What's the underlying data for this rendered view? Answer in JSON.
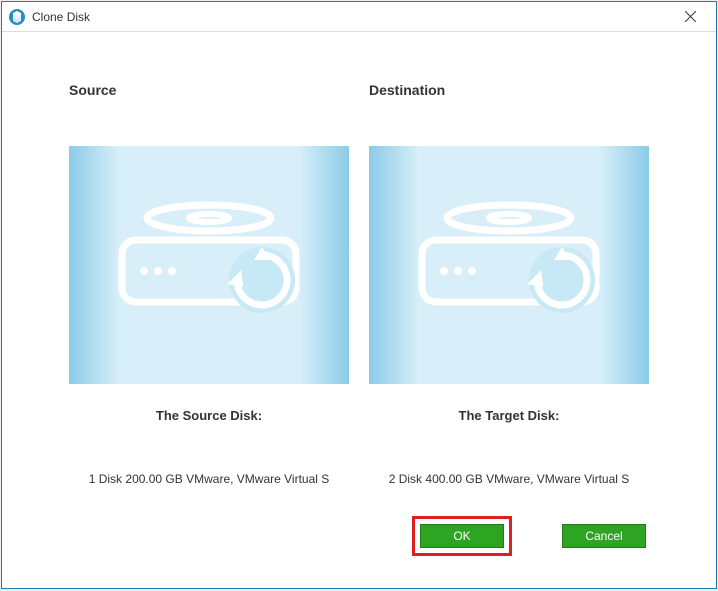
{
  "window": {
    "title": "Clone Disk"
  },
  "source": {
    "header": "Source",
    "subheader": "The Source Disk:",
    "description": "1 Disk 200.00 GB VMware,  VMware Virtual S"
  },
  "destination": {
    "header": "Destination",
    "subheader": "The Target Disk:",
    "description": "2 Disk 400.00 GB VMware,  VMware Virtual S"
  },
  "buttons": {
    "ok": "OK",
    "cancel": "Cancel"
  }
}
